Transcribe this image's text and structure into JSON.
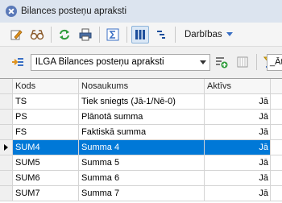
{
  "window": {
    "title": "Bilances posteņu apraksti"
  },
  "toolbar": {
    "actions_menu_label": "Darbības"
  },
  "selector": {
    "value": "ILGA Bilances posteņu apraksti",
    "filter_value": "_Āt"
  },
  "table": {
    "columns": [
      "Kods",
      "Nosaukums",
      "Aktīvs"
    ],
    "rows": [
      {
        "code": "TS",
        "name": "Tiek sniegts (Jā-1/Nē-0)",
        "active": "Jā"
      },
      {
        "code": "PS",
        "name": "Plānotā summa",
        "active": "Jā"
      },
      {
        "code": "FS",
        "name": "Faktiskā summa",
        "active": "Jā"
      },
      {
        "code": "SUM4",
        "name": "Summa 4",
        "active": "Jā",
        "selected": true
      },
      {
        "code": "SUM5",
        "name": "Summa 5",
        "active": "Jā"
      },
      {
        "code": "SUM6",
        "name": "Summa 6",
        "active": "Jā"
      },
      {
        "code": "SUM7",
        "name": "Summa 7",
        "active": "Jā"
      }
    ]
  },
  "colors": {
    "selection": "#0078d7",
    "accent_blue": "#3a6fc4",
    "green_icon": "#2e9b3a",
    "orange_icon": "#e0931e"
  },
  "icons": [
    "app-icon",
    "edit-icon",
    "view-icon",
    "refresh-icon",
    "print-icon",
    "sum-icon",
    "columns-icon",
    "indent-icon",
    "import-icon",
    "add-icon",
    "list-icon",
    "filter-icon"
  ]
}
